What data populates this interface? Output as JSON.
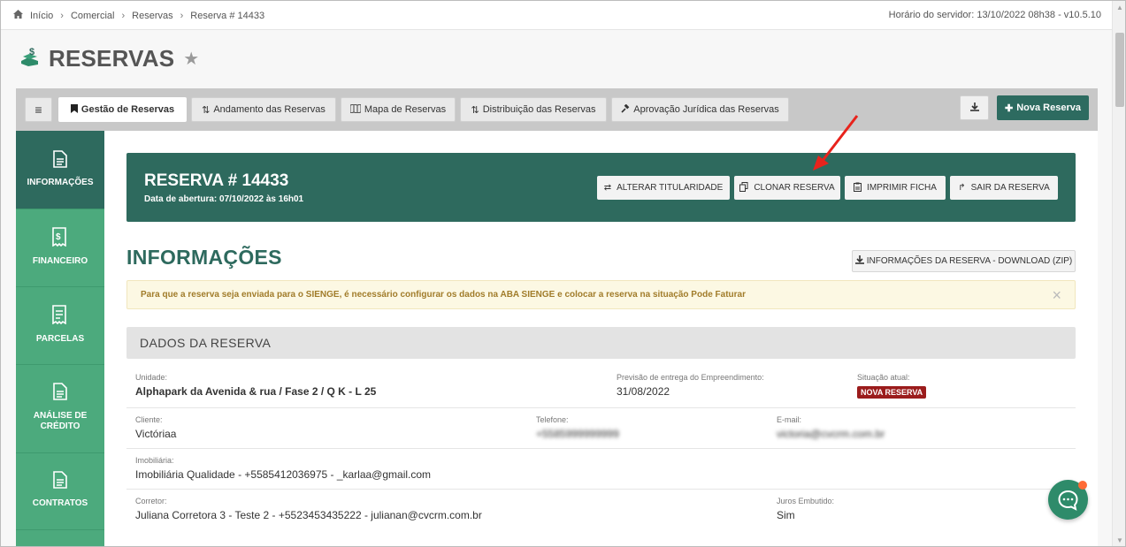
{
  "breadcrumb": {
    "items": [
      "Início",
      "Comercial",
      "Reservas",
      "Reserva # 14433"
    ],
    "server_time": "Horário do servidor: 13/10/2022 08h38 - v10.5.10"
  },
  "page": {
    "title": "RESERVAS"
  },
  "tabs": {
    "items": [
      {
        "label": "Gestão de Reservas"
      },
      {
        "label": "Andamento das Reservas"
      },
      {
        "label": "Mapa de Reservas"
      },
      {
        "label": "Distribuição das Reservas"
      },
      {
        "label": "Aprovação Jurídica das Reservas"
      }
    ],
    "new_button": "Nova Reserva"
  },
  "sidebar": {
    "items": [
      {
        "label": "INFORMAÇÕES"
      },
      {
        "label": "FINANCEIRO"
      },
      {
        "label": "PARCELAS"
      },
      {
        "label": "ANÁLISE DE CRÉDITO"
      },
      {
        "label": "CONTRATOS"
      }
    ]
  },
  "banner": {
    "title": "RESERVA # 14433",
    "subtitle": "Data de abertura: 07/10/2022 às 16h01",
    "buttons": [
      "ALTERAR TITULARIDADE",
      "CLONAR RESERVA",
      "IMPRIMIR FICHA",
      "SAIR DA RESERVA"
    ]
  },
  "section": {
    "title": "INFORMAÇÕES",
    "download_button": "INFORMAÇÕES DA RESERVA - DOWNLOAD (ZIP)",
    "warning": "Para que a reserva seja enviada para o SIENGE, é necessário configurar os dados na ABA SIENGE e colocar a reserva na situação Pode Faturar",
    "warning_close": "×",
    "data_header": "DADOS DA RESERVA"
  },
  "fields": {
    "unidade": {
      "label": "Unidade:",
      "value": "Alphapark da Avenida & rua / Fase 2 / Q K - L 25"
    },
    "previsao": {
      "label": "Previsão de entrega do Empreendimento:",
      "value": "31/08/2022"
    },
    "situacao": {
      "label": "Situação atual:",
      "value": "NOVA RESERVA"
    },
    "cliente": {
      "label": "Cliente:",
      "value": "Victóriaa"
    },
    "telefone": {
      "label": "Telefone:",
      "value": "+5585999999999"
    },
    "email": {
      "label": "E-mail:",
      "value": "victoria@cvcrm.com.br"
    },
    "imobiliaria": {
      "label": "Imobiliária:",
      "value": "Imobiliária Qualidade - +5585412036975 - _karlaa@gmail.com"
    },
    "corretor": {
      "label": "Corretor:",
      "value": "Juliana Corretora 3 - Teste 2 - +5523453435222 - julianan@cvcrm.com.br"
    },
    "juros": {
      "label": "Juros Embutido:",
      "value": "Sim"
    }
  },
  "colors": {
    "primary": "#2e6a5e",
    "sidebar": "#4caa7d",
    "badge": "#9b1c1c",
    "annotation": "#e8231c"
  }
}
